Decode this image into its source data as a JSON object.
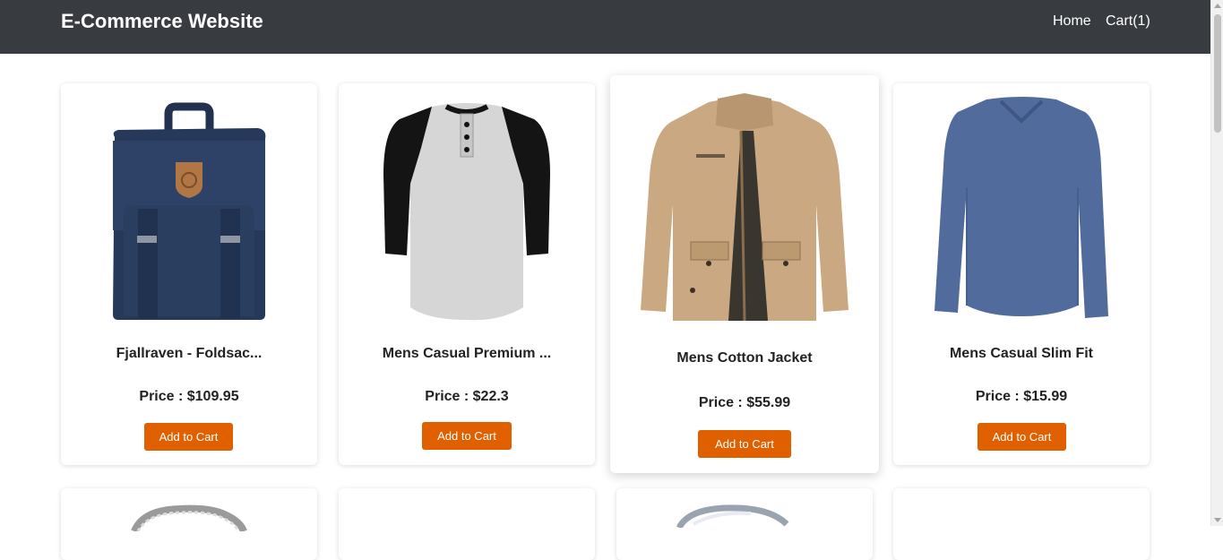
{
  "header": {
    "brand": "E-Commerce Website",
    "home_link": "Home",
    "cart_link": "Cart(1)"
  },
  "colors": {
    "navbar": "#383b40",
    "button": "#e06000"
  },
  "products": [
    {
      "title": "Fjallraven - Foldsac...",
      "price": "Price : $109.95",
      "button": "Add to Cart",
      "image": "backpack-image"
    },
    {
      "title": "Mens Casual Premium ...",
      "price": "Price : $22.3",
      "button": "Add to Cart",
      "image": "raglan-tshirt-image"
    },
    {
      "title": "Mens Cotton Jacket",
      "price": "Price : $55.99",
      "button": "Add to Cart",
      "image": "cotton-jacket-image"
    },
    {
      "title": "Mens Casual Slim Fit",
      "price": "Price : $15.99",
      "button": "Add to Cart",
      "image": "longsleeve-shirt-image"
    }
  ]
}
